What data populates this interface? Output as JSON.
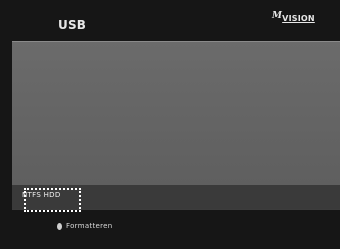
{
  "header": {
    "title": "USB",
    "logo_superscript": "M",
    "logo_text": "VISION"
  },
  "devices": [
    {
      "label": "NTFS HDD",
      "selected": true
    }
  ],
  "footer": {
    "icon": "circle-button-icon",
    "label": "Formatteren"
  },
  "colors": {
    "background": "#161616",
    "content_area": "#666666",
    "device_row": "#3a3a3a",
    "text": "#f2f2f2"
  }
}
